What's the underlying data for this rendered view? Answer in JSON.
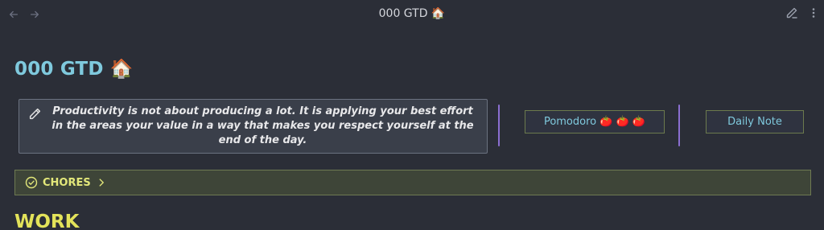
{
  "header": {
    "title": "000 GTD 🏠",
    "back_icon": "arrow-left-icon",
    "forward_icon": "arrow-right-icon",
    "edit_icon": "pencil-icon",
    "more_icon": "more-vertical-icon"
  },
  "page": {
    "title": "000 GTD 🏠"
  },
  "quote": {
    "icon": "pencil-icon",
    "text": "Productivity is not about producing a lot. It is applying your best effort in the areas your value in a way that makes you respect yourself at the end of the day."
  },
  "buttons": {
    "pomodoro": "Pomodoro 🍅 🍅 🍅",
    "daily_note": "Daily Note"
  },
  "chores": {
    "icon": "check-circle-icon",
    "label": "CHORES",
    "chevron_icon": "chevron-right-icon"
  },
  "sections": {
    "work": "WORK"
  },
  "colors": {
    "background": "#2b2e37",
    "title_accent": "#7fc9dd",
    "divider_accent": "#8b6fd1",
    "chores_text": "#e3e87a",
    "work_heading": "#e3e35a"
  }
}
